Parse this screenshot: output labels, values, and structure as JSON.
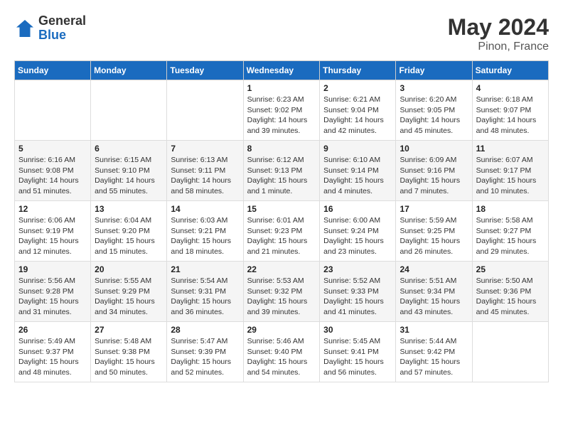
{
  "header": {
    "logo_line1": "General",
    "logo_line2": "Blue",
    "month_year": "May 2024",
    "location": "Pinon, France"
  },
  "days_of_week": [
    "Sunday",
    "Monday",
    "Tuesday",
    "Wednesday",
    "Thursday",
    "Friday",
    "Saturday"
  ],
  "weeks": [
    [
      {
        "day": "",
        "info": ""
      },
      {
        "day": "",
        "info": ""
      },
      {
        "day": "",
        "info": ""
      },
      {
        "day": "1",
        "info": "Sunrise: 6:23 AM\nSunset: 9:02 PM\nDaylight: 14 hours\nand 39 minutes."
      },
      {
        "day": "2",
        "info": "Sunrise: 6:21 AM\nSunset: 9:04 PM\nDaylight: 14 hours\nand 42 minutes."
      },
      {
        "day": "3",
        "info": "Sunrise: 6:20 AM\nSunset: 9:05 PM\nDaylight: 14 hours\nand 45 minutes."
      },
      {
        "day": "4",
        "info": "Sunrise: 6:18 AM\nSunset: 9:07 PM\nDaylight: 14 hours\nand 48 minutes."
      }
    ],
    [
      {
        "day": "5",
        "info": "Sunrise: 6:16 AM\nSunset: 9:08 PM\nDaylight: 14 hours\nand 51 minutes."
      },
      {
        "day": "6",
        "info": "Sunrise: 6:15 AM\nSunset: 9:10 PM\nDaylight: 14 hours\nand 55 minutes."
      },
      {
        "day": "7",
        "info": "Sunrise: 6:13 AM\nSunset: 9:11 PM\nDaylight: 14 hours\nand 58 minutes."
      },
      {
        "day": "8",
        "info": "Sunrise: 6:12 AM\nSunset: 9:13 PM\nDaylight: 15 hours\nand 1 minute."
      },
      {
        "day": "9",
        "info": "Sunrise: 6:10 AM\nSunset: 9:14 PM\nDaylight: 15 hours\nand 4 minutes."
      },
      {
        "day": "10",
        "info": "Sunrise: 6:09 AM\nSunset: 9:16 PM\nDaylight: 15 hours\nand 7 minutes."
      },
      {
        "day": "11",
        "info": "Sunrise: 6:07 AM\nSunset: 9:17 PM\nDaylight: 15 hours\nand 10 minutes."
      }
    ],
    [
      {
        "day": "12",
        "info": "Sunrise: 6:06 AM\nSunset: 9:19 PM\nDaylight: 15 hours\nand 12 minutes."
      },
      {
        "day": "13",
        "info": "Sunrise: 6:04 AM\nSunset: 9:20 PM\nDaylight: 15 hours\nand 15 minutes."
      },
      {
        "day": "14",
        "info": "Sunrise: 6:03 AM\nSunset: 9:21 PM\nDaylight: 15 hours\nand 18 minutes."
      },
      {
        "day": "15",
        "info": "Sunrise: 6:01 AM\nSunset: 9:23 PM\nDaylight: 15 hours\nand 21 minutes."
      },
      {
        "day": "16",
        "info": "Sunrise: 6:00 AM\nSunset: 9:24 PM\nDaylight: 15 hours\nand 23 minutes."
      },
      {
        "day": "17",
        "info": "Sunrise: 5:59 AM\nSunset: 9:25 PM\nDaylight: 15 hours\nand 26 minutes."
      },
      {
        "day": "18",
        "info": "Sunrise: 5:58 AM\nSunset: 9:27 PM\nDaylight: 15 hours\nand 29 minutes."
      }
    ],
    [
      {
        "day": "19",
        "info": "Sunrise: 5:56 AM\nSunset: 9:28 PM\nDaylight: 15 hours\nand 31 minutes."
      },
      {
        "day": "20",
        "info": "Sunrise: 5:55 AM\nSunset: 9:29 PM\nDaylight: 15 hours\nand 34 minutes."
      },
      {
        "day": "21",
        "info": "Sunrise: 5:54 AM\nSunset: 9:31 PM\nDaylight: 15 hours\nand 36 minutes."
      },
      {
        "day": "22",
        "info": "Sunrise: 5:53 AM\nSunset: 9:32 PM\nDaylight: 15 hours\nand 39 minutes."
      },
      {
        "day": "23",
        "info": "Sunrise: 5:52 AM\nSunset: 9:33 PM\nDaylight: 15 hours\nand 41 minutes."
      },
      {
        "day": "24",
        "info": "Sunrise: 5:51 AM\nSunset: 9:34 PM\nDaylight: 15 hours\nand 43 minutes."
      },
      {
        "day": "25",
        "info": "Sunrise: 5:50 AM\nSunset: 9:36 PM\nDaylight: 15 hours\nand 45 minutes."
      }
    ],
    [
      {
        "day": "26",
        "info": "Sunrise: 5:49 AM\nSunset: 9:37 PM\nDaylight: 15 hours\nand 48 minutes."
      },
      {
        "day": "27",
        "info": "Sunrise: 5:48 AM\nSunset: 9:38 PM\nDaylight: 15 hours\nand 50 minutes."
      },
      {
        "day": "28",
        "info": "Sunrise: 5:47 AM\nSunset: 9:39 PM\nDaylight: 15 hours\nand 52 minutes."
      },
      {
        "day": "29",
        "info": "Sunrise: 5:46 AM\nSunset: 9:40 PM\nDaylight: 15 hours\nand 54 minutes."
      },
      {
        "day": "30",
        "info": "Sunrise: 5:45 AM\nSunset: 9:41 PM\nDaylight: 15 hours\nand 56 minutes."
      },
      {
        "day": "31",
        "info": "Sunrise: 5:44 AM\nSunset: 9:42 PM\nDaylight: 15 hours\nand 57 minutes."
      },
      {
        "day": "",
        "info": ""
      }
    ]
  ]
}
